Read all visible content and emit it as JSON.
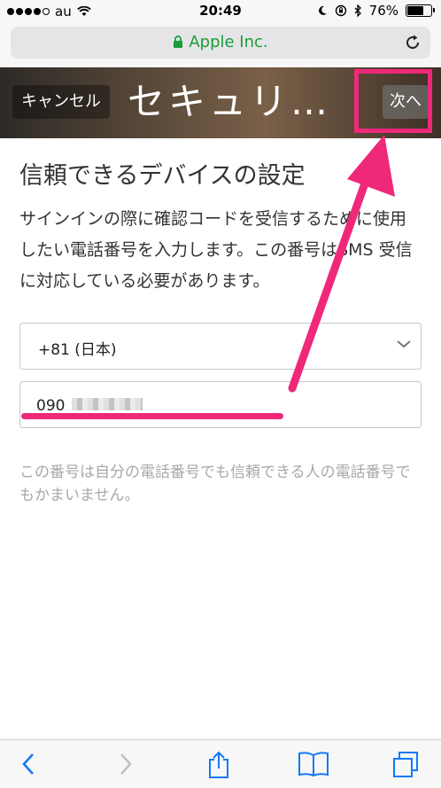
{
  "status_bar": {
    "carrier": "au",
    "time": "20:49",
    "battery_percent_label": "76%",
    "battery_level": 0.76,
    "signal_bars_filled": 4,
    "signal_bars_total": 5
  },
  "url_bar": {
    "site_label": "Apple Inc.",
    "accent_color": "#1a9d3a"
  },
  "header": {
    "cancel_label": "キャンセル",
    "title": "セキュリ…",
    "next_label": "次へ"
  },
  "main": {
    "page_title": "信頼できるデバイスの設定",
    "description": "サインインの際に確認コードを受信するために使用したい電話番号を入力します。この番号はSMS 受信に対応している必要があります。",
    "country_select_value": "+81 (日本)",
    "phone_value": "090",
    "note": "この番号は自分の電話番号でも信頼できる人の電話番号でもかまいません。"
  },
  "annotation": {
    "highlight_color": "#f0287a"
  },
  "icons": {
    "back": "chevron-left-icon",
    "forward": "chevron-right-icon",
    "share": "share-icon",
    "bookmarks": "book-icon",
    "tabs": "tabs-icon"
  }
}
